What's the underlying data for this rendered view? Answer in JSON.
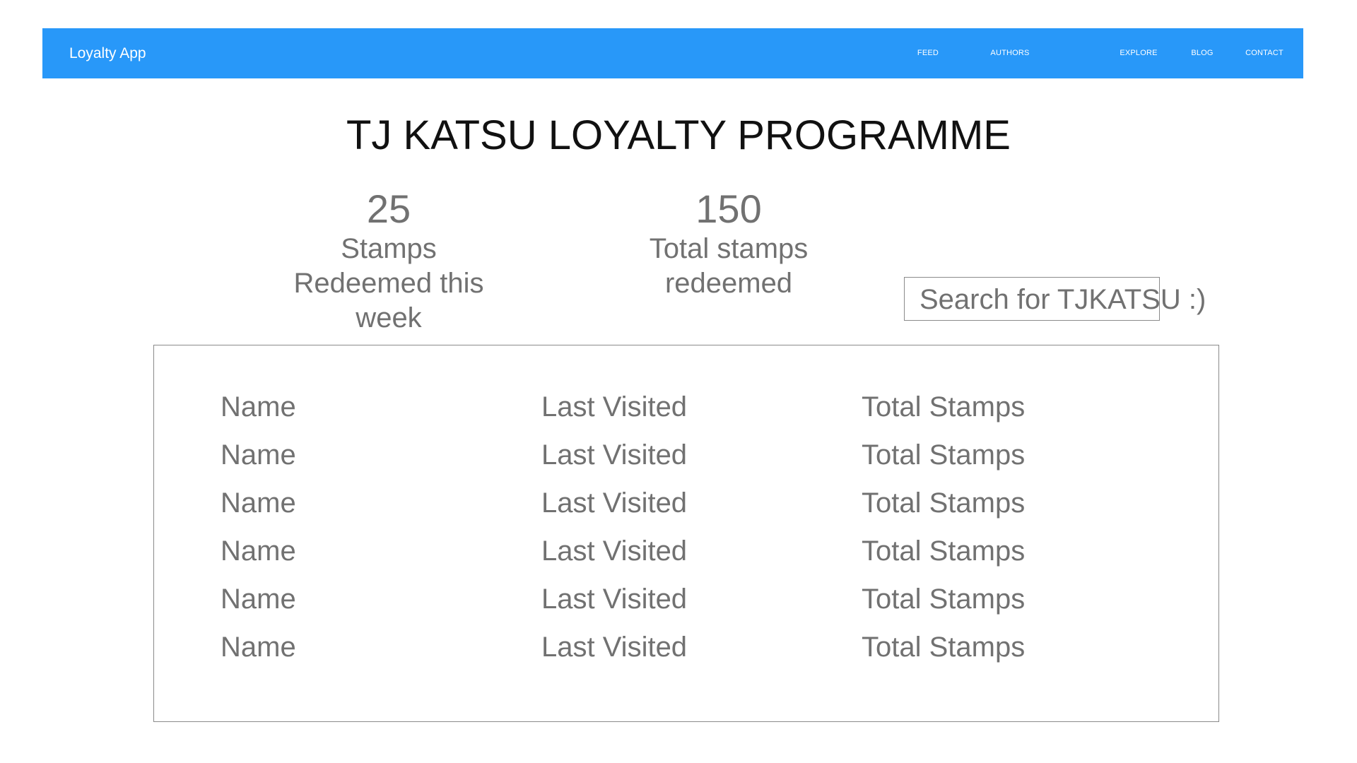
{
  "navbar": {
    "brand": "Loyalty App",
    "items": [
      {
        "label": "FEED"
      },
      {
        "label": "AUTHORS"
      },
      {
        "label": "EXPLORE"
      },
      {
        "label": "BLOG"
      },
      {
        "label": "CONTACT"
      }
    ],
    "background_color": "#2898f9"
  },
  "page_title": "TJ KATSU LOYALTY PROGRAMME",
  "stats": [
    {
      "value": "25",
      "label_lines": [
        "Stamps",
        "Redeemed this",
        "week"
      ]
    },
    {
      "value": "150",
      "label_lines": [
        "Total stamps",
        "redeemed"
      ]
    }
  ],
  "search": {
    "text": "Search for TJKATSU :)"
  },
  "table": {
    "rows": [
      [
        "Name",
        "Last Visited",
        "Total Stamps"
      ],
      [
        "Name",
        "Last Visited",
        "Total Stamps"
      ],
      [
        "Name",
        "Last Visited",
        "Total Stamps"
      ],
      [
        "Name",
        "Last Visited",
        "Total Stamps"
      ],
      [
        "Name",
        "Last Visited",
        "Total Stamps"
      ],
      [
        "Name",
        "Last Visited",
        "Total Stamps"
      ]
    ]
  }
}
